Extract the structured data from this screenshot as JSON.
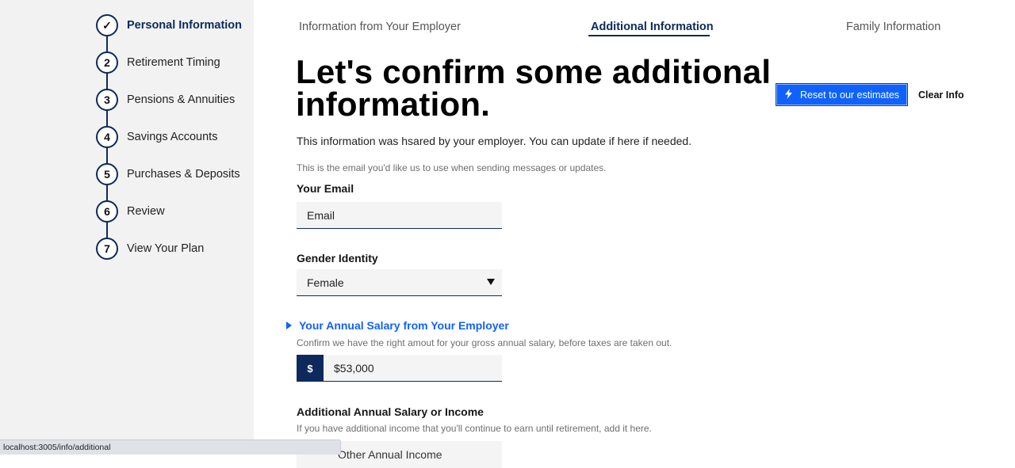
{
  "sidebar": {
    "steps": [
      {
        "number": "✓",
        "label": "Personal Information"
      },
      {
        "number": "2",
        "label": "Retirement Timing"
      },
      {
        "number": "3",
        "label": "Pensions & Annuities"
      },
      {
        "number": "4",
        "label": "Savings Accounts"
      },
      {
        "number": "5",
        "label": "Purchases & Deposits"
      },
      {
        "number": "6",
        "label": "Review"
      },
      {
        "number": "7",
        "label": "View Your Plan"
      }
    ]
  },
  "tabs": [
    {
      "label": "Information from Your Employer"
    },
    {
      "label": "Additional Information",
      "active": true
    },
    {
      "label": "Family Information"
    }
  ],
  "main": {
    "headline": "Let's confirm some additional information.",
    "reset_button": "Reset to our estimates",
    "clear_button": "Clear Info",
    "intro": "This information was hsared by your employer. You can update if here if needed.",
    "email": {
      "helper": "This is the email you'd like us to use when sending messages or updates.",
      "label": "Your Email",
      "placeholder": "Email"
    },
    "gender": {
      "label": "Gender Identity",
      "value": "Female"
    },
    "salary": {
      "label": "Your Annual Salary from Your Employer",
      "helper": "Confirm we have the right amout for your gross annual salary, before taxes are taken out.",
      "prefix": "$",
      "value": "$53,000"
    },
    "additional": {
      "label": "Additional Annual Salary or Income",
      "helper": "If you have additional income that you'll continue to earn until retirement, add it here.",
      "placeholder": "Other Annual Income"
    }
  },
  "statusbar": {
    "url": "localhost:3005/info/additional"
  },
  "colors": {
    "navy": "#0e2a5c",
    "accent_blue": "#0f62fe",
    "sidebar_bg": "#f2f2f2",
    "input_bg": "#f4f4f4"
  },
  "icons": [
    "check-icon",
    "bolt-icon",
    "caret-down-icon",
    "caret-right-icon"
  ]
}
